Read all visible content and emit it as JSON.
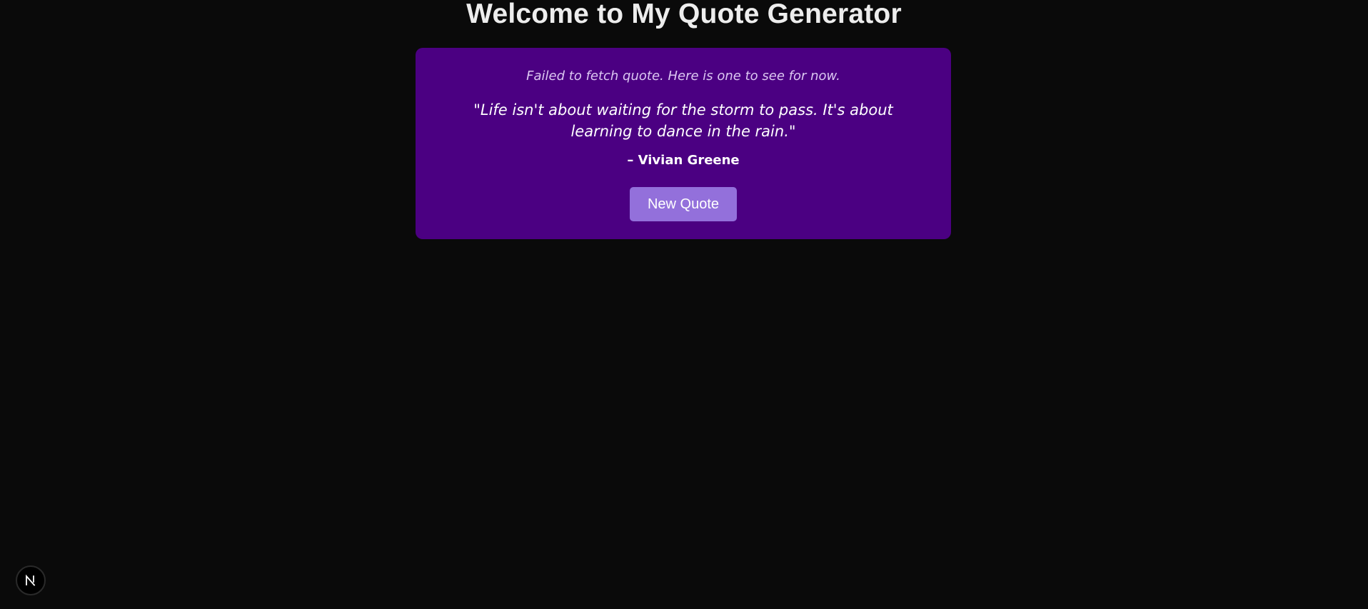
{
  "header": {
    "title": "Welcome to My Quote Generator"
  },
  "quote_card": {
    "status_message": "Failed to fetch quote. Here is one to see for now.",
    "quote_text": "\"Life isn't about waiting for the storm to pass. It's about learning to dance in the rain.\"",
    "author": "– Vivian Greene",
    "button_label": "New Quote"
  },
  "dev_badge": {
    "icon": "nextjs-logo-icon"
  },
  "colors": {
    "background": "#0a0a0a",
    "card": "#4b0082",
    "button": "#9370db",
    "title_text": "#ededed"
  }
}
